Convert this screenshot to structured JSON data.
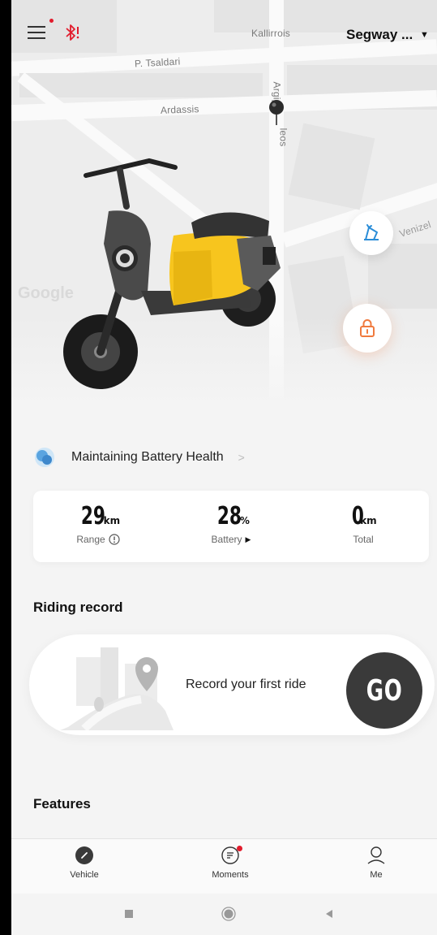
{
  "header": {
    "device_name": "Segway ...",
    "caret": "▼"
  },
  "map": {
    "labels": {
      "kallirrois": "Kallirrois",
      "tsaldari": "P. Tsaldari",
      "ardassis": "Ardassis",
      "argip": "Argip",
      "leos": "leos",
      "venizel": "Venizel",
      "google": "Google"
    }
  },
  "battery_health": {
    "label": "Maintaining Battery Health",
    "chevron": ">"
  },
  "stats": {
    "range": {
      "value": "29",
      "unit": "km",
      "label": "Range"
    },
    "battery": {
      "value": "28",
      "unit": "%",
      "label": "Battery",
      "play": "▶"
    },
    "total": {
      "value": "0",
      "unit": "km",
      "label": "Total"
    }
  },
  "riding_record": {
    "title": "Riding record",
    "prompt": "Record your first ride",
    "go_label": "GO"
  },
  "features": {
    "title": "Features"
  },
  "bottom_nav": {
    "items": [
      {
        "label": "Vehicle",
        "icon": "vehicle-icon"
      },
      {
        "label": "Moments",
        "icon": "moments-icon"
      },
      {
        "label": "Me",
        "icon": "me-icon"
      }
    ]
  },
  "colors": {
    "accent_orange": "#f07a3e",
    "nav_blue": "#2a8dd8",
    "scooter_yellow": "#f7c51e",
    "notification_red": "#e21b2c"
  }
}
